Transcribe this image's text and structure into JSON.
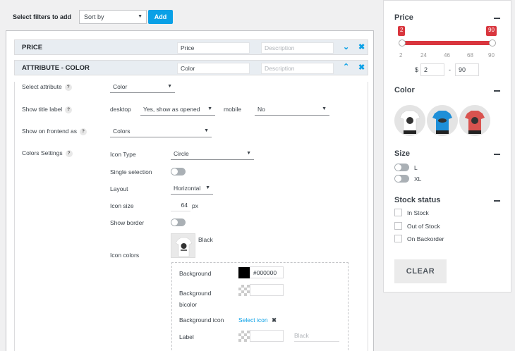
{
  "topbar": {
    "label": "Select filters to add",
    "sort_value": "Sort by",
    "add_label": "Add"
  },
  "filters": {
    "price": {
      "title": "PRICE",
      "name_value": "Price",
      "desc_placeholder": "Description"
    },
    "color": {
      "title": "ATTRIBUTE - COLOR",
      "name_value": "Color",
      "desc_placeholder": "Description"
    }
  },
  "settings": {
    "select_attribute_label": "Select attribute",
    "select_attribute_value": "Color",
    "show_title_label": "Show title label",
    "desktop_label": "desktop",
    "desktop_value": "Yes, show as opened",
    "mobile_label": "mobile",
    "mobile_value": "No",
    "show_frontend_label": "Show on frontend as",
    "show_frontend_value": "Colors",
    "colors_settings_label": "Colors Settings",
    "icon_type_label": "Icon Type",
    "icon_type_value": "Circle",
    "single_selection_label": "Single selection",
    "layout_label": "Layout",
    "layout_value": "Horizontal",
    "icon_size_label": "Icon size",
    "icon_size_value": "64",
    "icon_size_unit": "px",
    "show_border_label": "Show border",
    "icon_colors_label": "Icon colors",
    "icon_color_name": "Black",
    "background_label": "Background",
    "background_value": "#000000",
    "background_color": "#000000",
    "background_bicolor_label": "Background bicolor",
    "background_icon_label": "Background icon",
    "select_icon_label": "Select icon",
    "label_label": "Label",
    "label_placeholder": "Black",
    "help_mark": "?"
  },
  "sidebar": {
    "price_title": "Price",
    "price_min": "2",
    "price_max": "90",
    "ticks": [
      "2",
      "24",
      "46",
      "68",
      "90"
    ],
    "currency": "$",
    "input_min": "2",
    "separator": "-",
    "input_max": "90",
    "color_title": "Color",
    "size_title": "Size",
    "sizes": [
      "L",
      "XL"
    ],
    "stock_title": "Stock status",
    "stock_options": [
      "In Stock",
      "Out of Stock",
      "On Backorder"
    ],
    "clear_label": "CLEAR",
    "color_swatches": [
      "#ffffff",
      "#1e8fd8",
      "#d9534f"
    ]
  },
  "colors": {
    "accent": "#0aa0e6",
    "range": "#d9363e"
  }
}
